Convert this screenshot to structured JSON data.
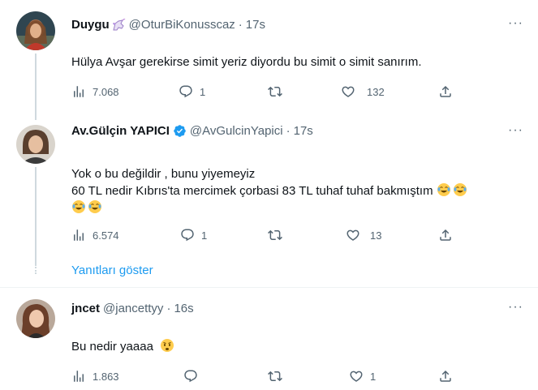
{
  "tweets": [
    {
      "name": "Duygu",
      "name_emoji_icon": "unicorn-icon",
      "handle": "@OturBiKonusscaz",
      "time": "17s",
      "text": "Hülya Avşar gerekirse simit yeriz diyordu bu simit o simit sanırım.",
      "views": "7.068",
      "replies": "1",
      "retweets": "",
      "likes": "132"
    },
    {
      "name": "Av.Gülçin YAPICI",
      "verified_icon": "verified-badge-icon",
      "handle": "@AvGulcinYapici",
      "time": "17s",
      "text_line1": "Yok o bu değildir , bunu yiyemeyiz",
      "text_line2": "60 TL nedir Kıbrıs'ta  mercimek çorbasi 83 TL tuhaf tuhaf bakmıştım",
      "text_emoji": [
        "tears-of-joy-emoji",
        "tears-of-joy-emoji",
        "tears-of-joy-emoji",
        "tears-of-joy-emoji"
      ],
      "views": "6.574",
      "replies": "1",
      "retweets": "",
      "likes": "13",
      "show_replies": "Yanıtları göster"
    },
    {
      "name": "jncet",
      "handle": "@jancettyy",
      "time": "16s",
      "text": "Bu nedir yaaaa",
      "text_emoji": "worried-face-emoji",
      "views": "1.863",
      "replies": "",
      "retweets": "",
      "likes": "1"
    }
  ],
  "colors": {
    "accent": "#1d9bf0",
    "secondary_text": "#536471",
    "divider": "#eff3f4",
    "thread_line": "#cfd9de"
  }
}
